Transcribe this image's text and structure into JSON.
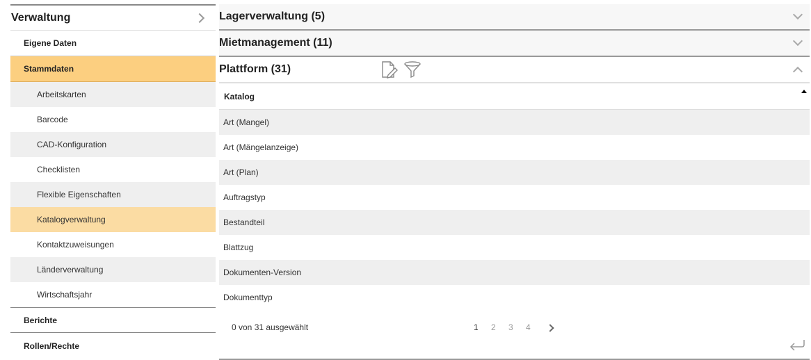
{
  "sidebar": {
    "title": "Verwaltung",
    "groups": {
      "eigene": "Eigene Daten",
      "stammdaten": "Stammdaten",
      "berichte": "Berichte",
      "rollen": "Rollen/Rechte"
    },
    "sub_items": [
      "Arbeitskarten",
      "Barcode",
      "CAD-Konfiguration",
      "Checklisten",
      "Flexible Eigenschaften",
      "Katalogverwaltung",
      "Kontaktzuweisungen",
      "Länderverwaltung",
      "Wirtschaftsjahr"
    ]
  },
  "main": {
    "sections": [
      "Lagerverwaltung (5)",
      "Mietmanagement (11)",
      "Plattform (31)"
    ],
    "table": {
      "column": "Katalog",
      "rows": [
        "Art (Mangel)",
        "Art (Mängelanzeige)",
        "Art (Plan)",
        "Auftragstyp",
        "Bestandteil",
        "Blattzug",
        "Dokumenten-Version",
        "Dokumenttyp"
      ]
    },
    "footer": {
      "selection": "0 von 31 ausgewählt",
      "pages": [
        "1",
        "2",
        "3",
        "4"
      ]
    }
  },
  "icons": {
    "edit": "document-edit-icon",
    "filter": "filter-icon",
    "return": "return-icon"
  },
  "colors": {
    "active_group": "#fccf80",
    "selected_item": "#fbdca3"
  }
}
